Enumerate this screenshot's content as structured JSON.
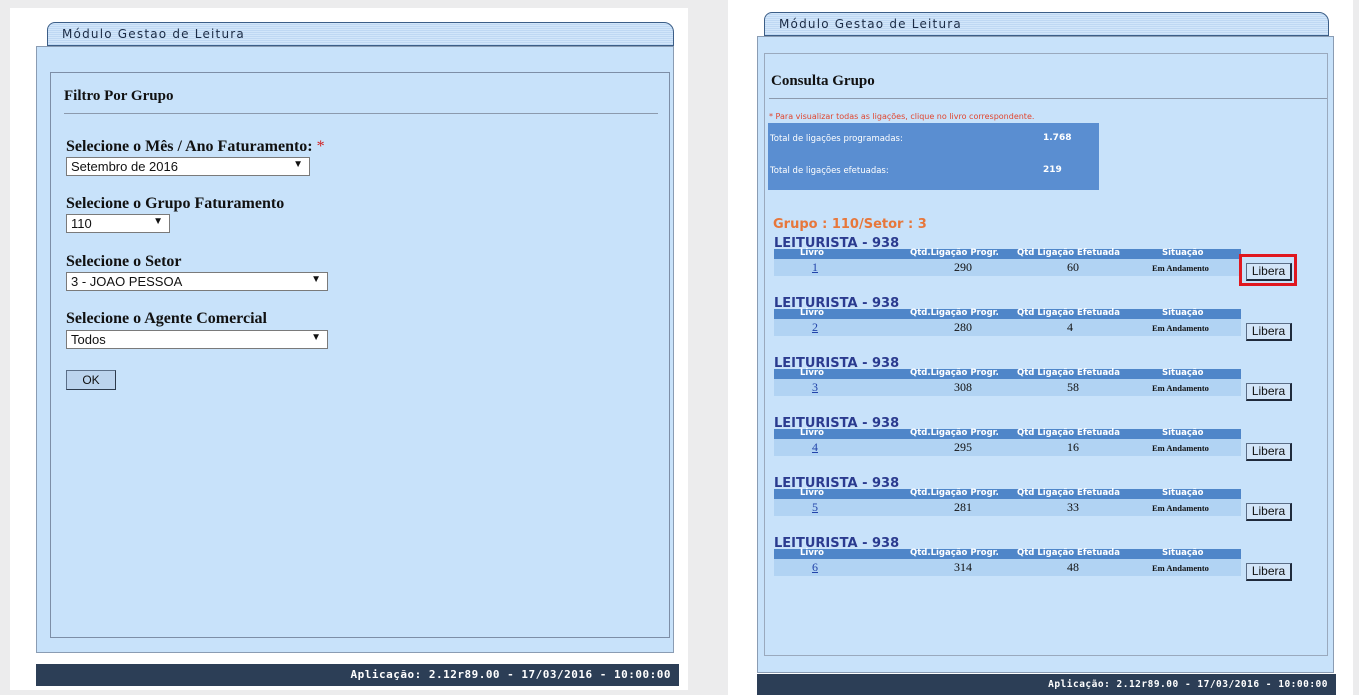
{
  "left": {
    "module_title": "Módulo Gestao de Leitura",
    "section_title": "Filtro Por Grupo",
    "fields": {
      "mes_ano": {
        "label": "Selecione o Mês / Ano Faturamento:",
        "required_mark": "*",
        "value": "Setembro de 2016"
      },
      "grupo": {
        "label": "Selecione o Grupo Faturamento",
        "value": "110"
      },
      "setor": {
        "label": "Selecione o Setor",
        "value": "3 - JOAO PESSOA"
      },
      "agente": {
        "label": "Selecione o Agente Comercial",
        "value": "Todos"
      }
    },
    "ok_label": "OK",
    "footer": "Aplicação: 2.12r89.00 - 17/03/2016 - 10:00:00"
  },
  "right": {
    "module_title": "Módulo Gestao de Leitura",
    "section_title": "Consulta Grupo",
    "note": "* Para visualizar todas as ligações, clique no livro correspondente.",
    "stats": {
      "programadas_label": "Total de ligações programadas:",
      "programadas_value": "1.768",
      "efetuadas_label": "Total de ligações efetuadas:",
      "efetuadas_value": "219"
    },
    "grupo_setor": "Grupo : 110/Setor : 3",
    "columns": [
      "Livro",
      "Qtd.Ligação Progr.",
      "Qtd Ligação Efetuada",
      "Situação"
    ],
    "blocks": [
      {
        "leiturista": "LEITURISTA - 938",
        "livro": "1",
        "progr": "290",
        "efetuada": "60",
        "situacao": "Em Andamento",
        "action": "Libera"
      },
      {
        "leiturista": "LEITURISTA - 938",
        "livro": "2",
        "progr": "280",
        "efetuada": "4",
        "situacao": "Em Andamento",
        "action": "Libera"
      },
      {
        "leiturista": "LEITURISTA - 938",
        "livro": "3",
        "progr": "308",
        "efetuada": "58",
        "situacao": "Em Andamento",
        "action": "Libera"
      },
      {
        "leiturista": "LEITURISTA - 938",
        "livro": "4",
        "progr": "295",
        "efetuada": "16",
        "situacao": "Em Andamento",
        "action": "Libera"
      },
      {
        "leiturista": "LEITURISTA - 938",
        "livro": "5",
        "progr": "281",
        "efetuada": "33",
        "situacao": "Em Andamento",
        "action": "Libera"
      },
      {
        "leiturista": "LEITURISTA - 938",
        "livro": "6",
        "progr": "314",
        "efetuada": "48",
        "situacao": "Em Andamento",
        "action": "Libera"
      }
    ],
    "footer": "Aplicação: 2.12r89.00 - 17/03/2016 - 10:00:00",
    "highlight_color": "#e0171f"
  },
  "icons": {
    "select_arrow": "triangle-down"
  }
}
